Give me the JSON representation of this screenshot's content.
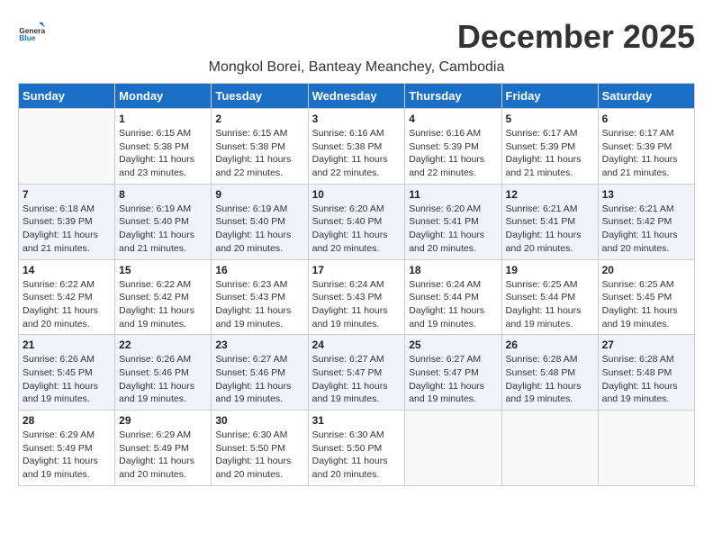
{
  "header": {
    "logo_general": "General",
    "logo_blue": "Blue",
    "month_title": "December 2025",
    "subtitle": "Mongkol Borei, Banteay Meanchey, Cambodia"
  },
  "days_of_week": [
    "Sunday",
    "Monday",
    "Tuesday",
    "Wednesday",
    "Thursday",
    "Friday",
    "Saturday"
  ],
  "weeks": [
    [
      {
        "day": "",
        "info": ""
      },
      {
        "day": "1",
        "info": "Sunrise: 6:15 AM\nSunset: 5:38 PM\nDaylight: 11 hours and 23 minutes."
      },
      {
        "day": "2",
        "info": "Sunrise: 6:15 AM\nSunset: 5:38 PM\nDaylight: 11 hours and 22 minutes."
      },
      {
        "day": "3",
        "info": "Sunrise: 6:16 AM\nSunset: 5:38 PM\nDaylight: 11 hours and 22 minutes."
      },
      {
        "day": "4",
        "info": "Sunrise: 6:16 AM\nSunset: 5:39 PM\nDaylight: 11 hours and 22 minutes."
      },
      {
        "day": "5",
        "info": "Sunrise: 6:17 AM\nSunset: 5:39 PM\nDaylight: 11 hours and 21 minutes."
      },
      {
        "day": "6",
        "info": "Sunrise: 6:17 AM\nSunset: 5:39 PM\nDaylight: 11 hours and 21 minutes."
      }
    ],
    [
      {
        "day": "7",
        "info": "Sunrise: 6:18 AM\nSunset: 5:39 PM\nDaylight: 11 hours and 21 minutes."
      },
      {
        "day": "8",
        "info": "Sunrise: 6:19 AM\nSunset: 5:40 PM\nDaylight: 11 hours and 21 minutes."
      },
      {
        "day": "9",
        "info": "Sunrise: 6:19 AM\nSunset: 5:40 PM\nDaylight: 11 hours and 20 minutes."
      },
      {
        "day": "10",
        "info": "Sunrise: 6:20 AM\nSunset: 5:40 PM\nDaylight: 11 hours and 20 minutes."
      },
      {
        "day": "11",
        "info": "Sunrise: 6:20 AM\nSunset: 5:41 PM\nDaylight: 11 hours and 20 minutes."
      },
      {
        "day": "12",
        "info": "Sunrise: 6:21 AM\nSunset: 5:41 PM\nDaylight: 11 hours and 20 minutes."
      },
      {
        "day": "13",
        "info": "Sunrise: 6:21 AM\nSunset: 5:42 PM\nDaylight: 11 hours and 20 minutes."
      }
    ],
    [
      {
        "day": "14",
        "info": "Sunrise: 6:22 AM\nSunset: 5:42 PM\nDaylight: 11 hours and 20 minutes."
      },
      {
        "day": "15",
        "info": "Sunrise: 6:22 AM\nSunset: 5:42 PM\nDaylight: 11 hours and 19 minutes."
      },
      {
        "day": "16",
        "info": "Sunrise: 6:23 AM\nSunset: 5:43 PM\nDaylight: 11 hours and 19 minutes."
      },
      {
        "day": "17",
        "info": "Sunrise: 6:24 AM\nSunset: 5:43 PM\nDaylight: 11 hours and 19 minutes."
      },
      {
        "day": "18",
        "info": "Sunrise: 6:24 AM\nSunset: 5:44 PM\nDaylight: 11 hours and 19 minutes."
      },
      {
        "day": "19",
        "info": "Sunrise: 6:25 AM\nSunset: 5:44 PM\nDaylight: 11 hours and 19 minutes."
      },
      {
        "day": "20",
        "info": "Sunrise: 6:25 AM\nSunset: 5:45 PM\nDaylight: 11 hours and 19 minutes."
      }
    ],
    [
      {
        "day": "21",
        "info": "Sunrise: 6:26 AM\nSunset: 5:45 PM\nDaylight: 11 hours and 19 minutes."
      },
      {
        "day": "22",
        "info": "Sunrise: 6:26 AM\nSunset: 5:46 PM\nDaylight: 11 hours and 19 minutes."
      },
      {
        "day": "23",
        "info": "Sunrise: 6:27 AM\nSunset: 5:46 PM\nDaylight: 11 hours and 19 minutes."
      },
      {
        "day": "24",
        "info": "Sunrise: 6:27 AM\nSunset: 5:47 PM\nDaylight: 11 hours and 19 minutes."
      },
      {
        "day": "25",
        "info": "Sunrise: 6:27 AM\nSunset: 5:47 PM\nDaylight: 11 hours and 19 minutes."
      },
      {
        "day": "26",
        "info": "Sunrise: 6:28 AM\nSunset: 5:48 PM\nDaylight: 11 hours and 19 minutes."
      },
      {
        "day": "27",
        "info": "Sunrise: 6:28 AM\nSunset: 5:48 PM\nDaylight: 11 hours and 19 minutes."
      }
    ],
    [
      {
        "day": "28",
        "info": "Sunrise: 6:29 AM\nSunset: 5:49 PM\nDaylight: 11 hours and 19 minutes."
      },
      {
        "day": "29",
        "info": "Sunrise: 6:29 AM\nSunset: 5:49 PM\nDaylight: 11 hours and 20 minutes."
      },
      {
        "day": "30",
        "info": "Sunrise: 6:30 AM\nSunset: 5:50 PM\nDaylight: 11 hours and 20 minutes."
      },
      {
        "day": "31",
        "info": "Sunrise: 6:30 AM\nSunset: 5:50 PM\nDaylight: 11 hours and 20 minutes."
      },
      {
        "day": "",
        "info": ""
      },
      {
        "day": "",
        "info": ""
      },
      {
        "day": "",
        "info": ""
      }
    ]
  ]
}
